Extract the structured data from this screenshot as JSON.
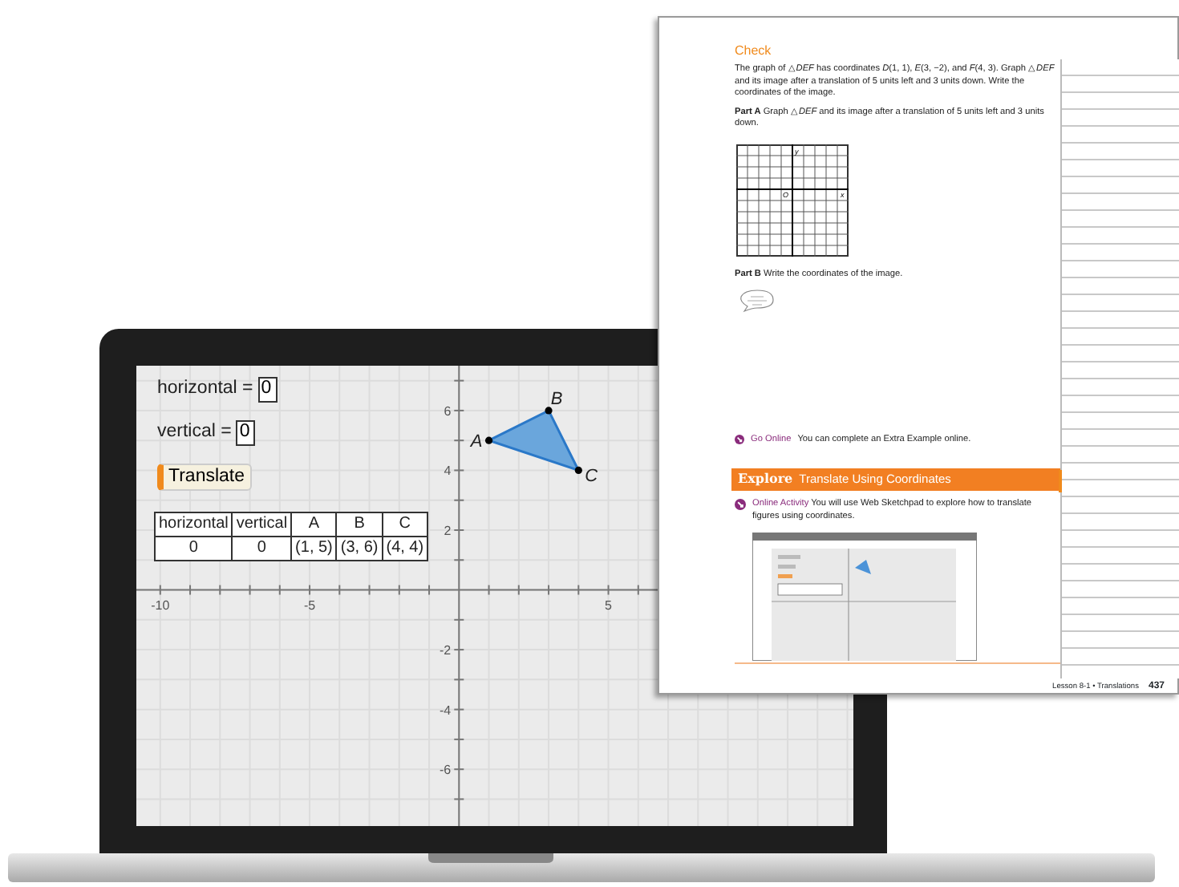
{
  "app": {
    "fields": [
      {
        "label": "horizontal =",
        "value": "0"
      },
      {
        "label": "vertical =",
        "value": "0"
      }
    ],
    "button": "Translate",
    "table": {
      "columns": [
        "horizontal",
        "vertical",
        "A",
        "B",
        "C"
      ],
      "rows": [
        [
          "0",
          "0",
          "(1, 5)",
          "(3, 6)",
          "(4, 4)"
        ]
      ]
    },
    "graph": {
      "chart_data": {
        "type": "scatter",
        "x": [
          1,
          3,
          4
        ],
        "series": [
          {
            "color": "#000000",
            "values": [
              5,
              6,
              4
            ]
          }
        ],
        "grid": true,
        "xlim": [
          -10.8,
          13.2
        ],
        "ylim": [
          -7.9,
          7.5
        ],
        "xticks": [
          -10,
          -5,
          5
        ],
        "yticks": [
          -6,
          -4,
          -2,
          2,
          4,
          6
        ],
        "annotations": [
          {
            "text": "A",
            "x": 1,
            "y": 5
          },
          {
            "text": "B",
            "x": 3,
            "y": 6
          },
          {
            "text": "C",
            "x": 4,
            "y": 4
          }
        ]
      }
    }
  },
  "page": {
    "heading": "Check",
    "problem": "The graph of △*DEF* has coordinates *D*(1, 1), *E*(3, −2), and *F*(4, 3). Graph △*DEF* and its image after a translation of 5 units left and 3 units down. Write the coordinates of the image.",
    "part_a": "**Part A**  Graph △*DEF* and its image after a translation of 5 units left and 3 units down.",
    "grid_labels": [
      "y",
      "O",
      "x"
    ],
    "part_b": "**Part B**  Write the coordinates of the image.",
    "go_online": {
      "link": "Go Online",
      "text": "You can complete an Extra Example online."
    },
    "banner": {
      "title": "Explore",
      "subtitle": "Translate Using Coordinates"
    },
    "online_activity": {
      "link": "Online Activity",
      "text": "You will use Web Sketchpad to explore how to translate figures using coordinates."
    },
    "footer": {
      "lesson": "Lesson 8-1 • Translations",
      "page_number": "437"
    }
  }
}
